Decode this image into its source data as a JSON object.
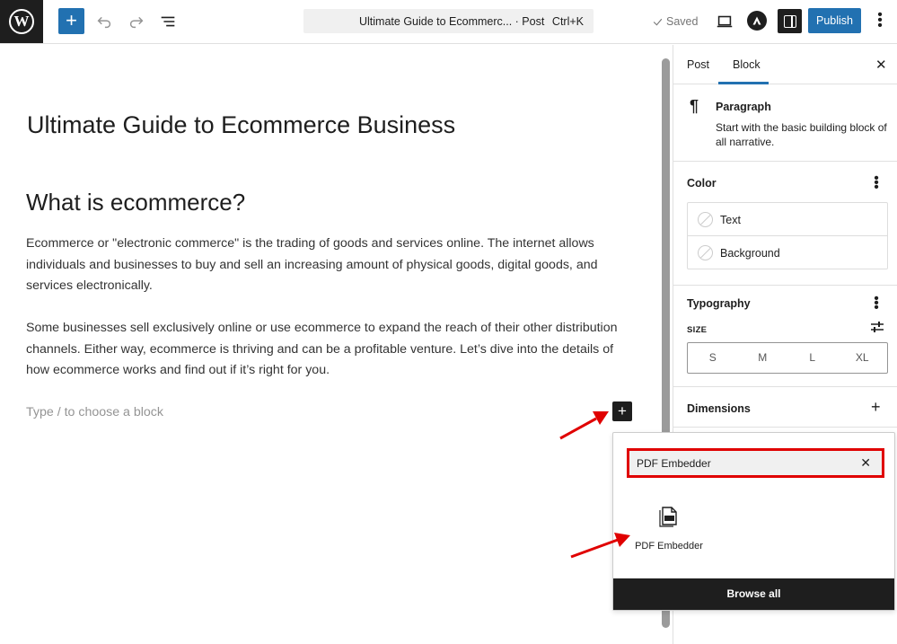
{
  "toolbar": {
    "command_title": "Ultimate Guide to Ecommerc... · Post",
    "command_shortcut": "Ctrl+K",
    "saved_label": "Saved",
    "publish_label": "Publish"
  },
  "editor": {
    "post_title": "Ultimate Guide to Ecommerce Business",
    "heading": "What is ecommerce?",
    "paragraphs": [
      "Ecommerce or \"electronic commerce\" is the trading of goods and services online. The internet allows individuals and businesses to buy and sell an increasing amount of physical goods, digital goods, and services electronically.",
      "Some businesses sell exclusively online or use ecommerce to expand the reach of their other distribution channels. Either way, ecommerce is thriving and can be a profitable venture. Let’s dive into the details of how ecommerce works and find out if it’s right for you."
    ],
    "placeholder": "Type / to choose a block"
  },
  "sidebar": {
    "tabs": [
      "Post",
      "Block"
    ],
    "active_tab": "Block",
    "block_card": {
      "title": "Paragraph",
      "description": "Start with the basic building block of all narrative."
    },
    "color": {
      "heading": "Color",
      "items": [
        "Text",
        "Background"
      ]
    },
    "typography": {
      "heading": "Typography",
      "size_label": "SIZE",
      "sizes": [
        "S",
        "M",
        "L",
        "XL"
      ]
    },
    "dimensions": {
      "heading": "Dimensions"
    }
  },
  "inserter": {
    "search_value": "PDF Embedder",
    "result_label": "PDF Embedder",
    "browse_all_label": "Browse all"
  },
  "colors": {
    "accent": "#2271b1",
    "dark": "#1e1e1e",
    "highlight": "#e00000"
  }
}
